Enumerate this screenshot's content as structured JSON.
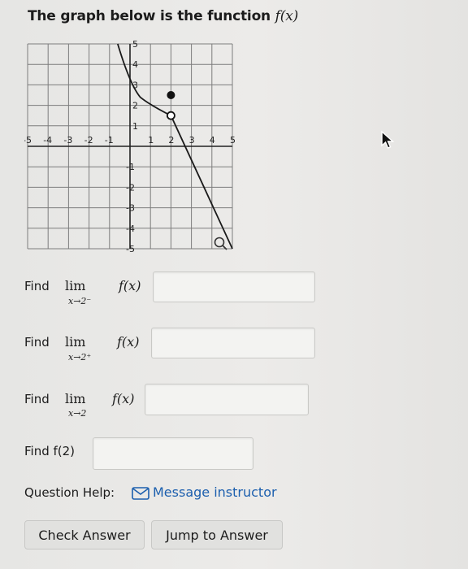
{
  "question": {
    "title_prefix": "The graph below is the function ",
    "title_fx": "f(x)"
  },
  "graph": {
    "x_ticks": [
      "-5",
      "-4",
      "-3",
      "-2",
      "-1",
      "1",
      "2",
      "3",
      "4",
      "5"
    ],
    "y_ticks": [
      "5",
      "4",
      "3",
      "2",
      "1",
      "-1",
      "-2",
      "-3",
      "-4",
      "-5"
    ],
    "xlim": [
      -5,
      5
    ],
    "ylim": [
      -5,
      5
    ],
    "curve": [
      [
        -0.6,
        5
      ],
      [
        0,
        3
      ],
      [
        0.5,
        2.4
      ],
      [
        1,
        2
      ],
      [
        2,
        1.5
      ],
      [
        5,
        -5
      ]
    ],
    "closed_point": [
      2,
      2.5
    ],
    "open_point": [
      2,
      1.5
    ],
    "magnifier_icon": "magnifier-icon"
  },
  "parts": [
    {
      "find": "Find",
      "lim": "lim",
      "sub": "x→2⁻",
      "fx": "f(x)",
      "answer": ""
    },
    {
      "find": "Find",
      "lim": "lim",
      "sub": "x→2⁺",
      "fx": "f(x)",
      "answer": ""
    },
    {
      "find": "Find",
      "lim": "lim",
      "sub": "x→2",
      "fx": "f(x)",
      "answer": ""
    },
    {
      "find": "Find f(2)",
      "answer": ""
    }
  ],
  "help": {
    "label": "Question Help:",
    "icon": "mail-icon",
    "link": "Message instructor"
  },
  "buttons": {
    "check": "Check Answer",
    "jump": "Jump to Answer"
  },
  "colors": {
    "link": "#1c5fae",
    "grid": "#7d7d7d",
    "curve": "#1a1a1a"
  }
}
